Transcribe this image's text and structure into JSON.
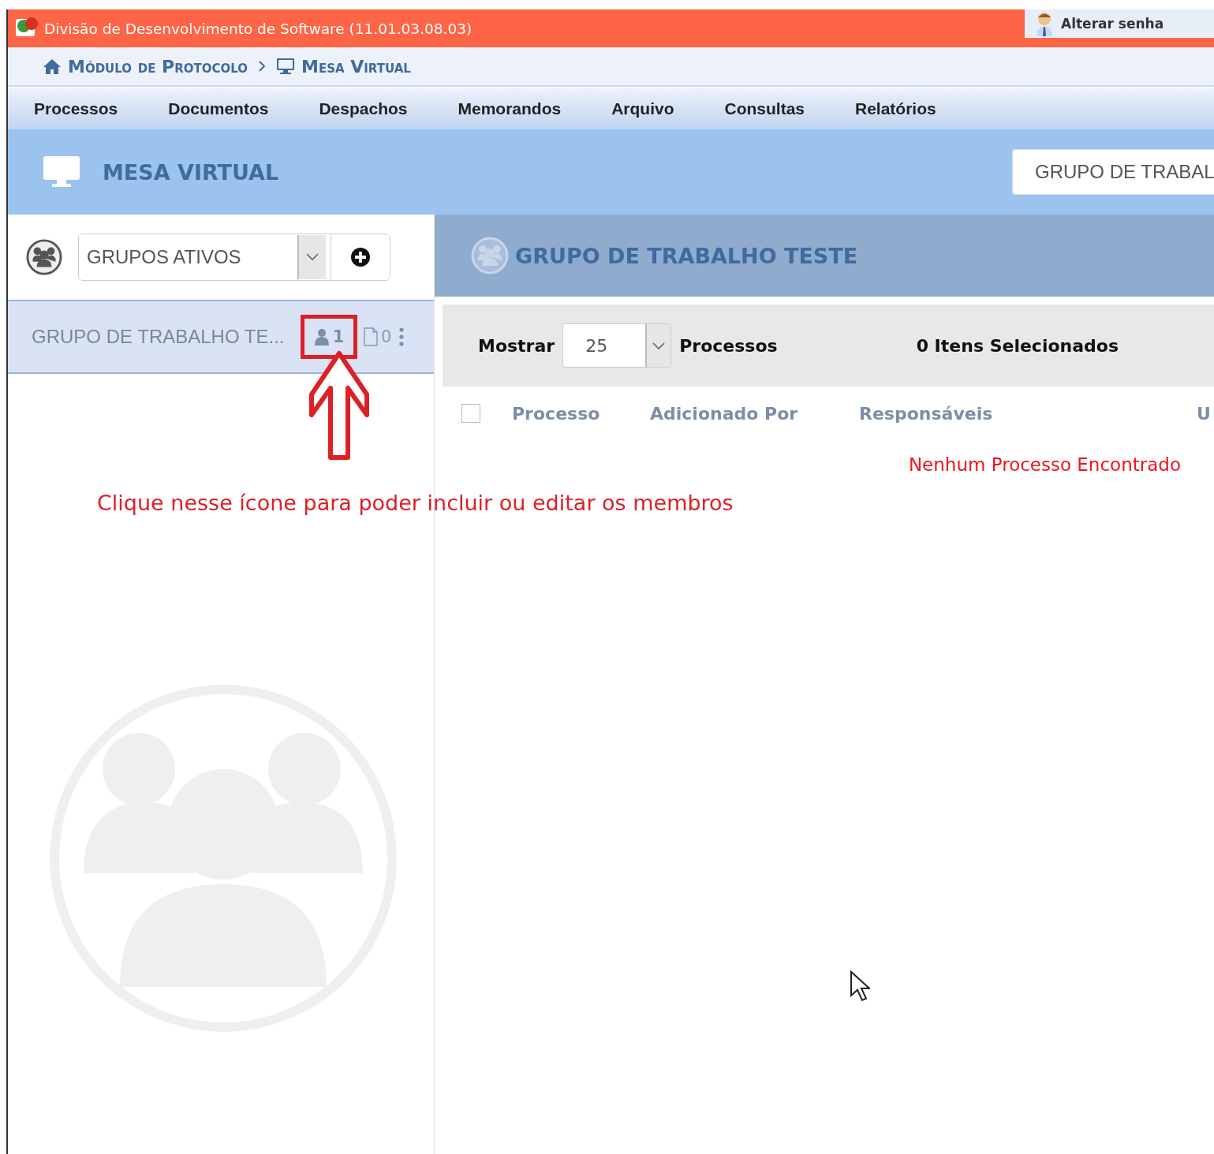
{
  "top_bar": {
    "title": "Divisão de Desenvolvimento de Software (11.01.03.08.03)",
    "action": "Alterar senha"
  },
  "breadcrumb": [
    {
      "label": "Módulo de Protocolo",
      "kind": "home"
    },
    {
      "label": "Mesa Virtual",
      "kind": "monitor"
    }
  ],
  "menu": [
    "Processos",
    "Documentos",
    "Despachos",
    "Memorandos",
    "Arquivo",
    "Consultas",
    "Relatórios"
  ],
  "page_header": {
    "title": "MESA VIRTUAL",
    "group_select": "GRUPO DE TRABAL"
  },
  "sidebar": {
    "filter": "GRUPOS ATIVOS",
    "groups": [
      {
        "name": "GRUPO DE TRABALHO TE...",
        "members": "1",
        "documents": "0",
        "selected": true
      }
    ]
  },
  "content": {
    "title": "GRUPO DE TRABALHO TESTE",
    "show_label": "Mostrar",
    "page_size": "25",
    "unit_label": "Processos",
    "selection_count": "0 Itens Selecionados",
    "select_all_checked": false,
    "columns": [
      "Processo",
      "Adicionado Por",
      "Responsáveis",
      "U"
    ],
    "empty_message": "Nenhum Processo Encontrado"
  },
  "annotation": {
    "text": "Clique nesse ícone para poder incluir ou editar os membros"
  }
}
